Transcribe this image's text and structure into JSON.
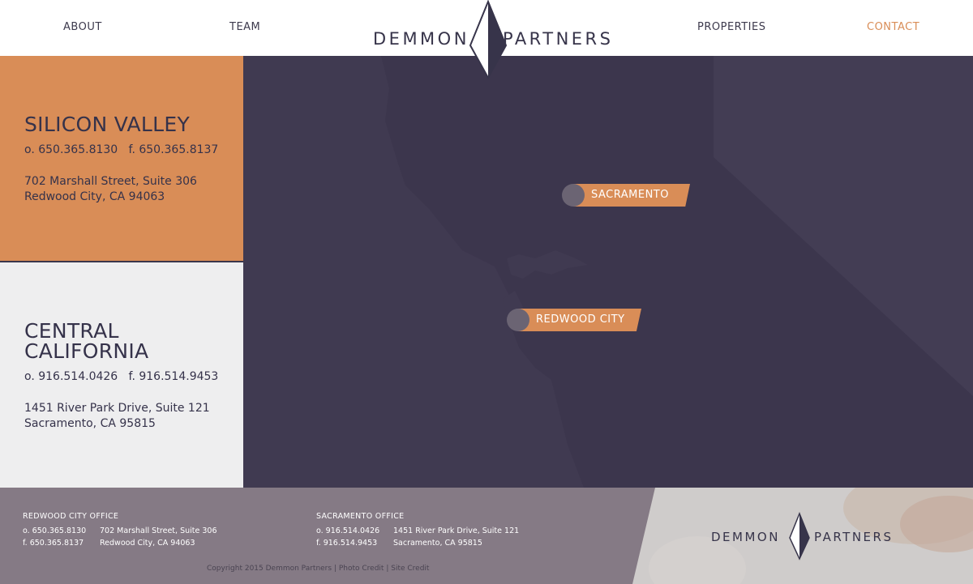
{
  "nav": {
    "about": "ABOUT",
    "team": "TEAM",
    "properties": "PROPERTIES",
    "contact": "CONTACT"
  },
  "logo": {
    "left": "DEMMON",
    "right": "PARTNERS"
  },
  "offices": [
    {
      "title": "SILICON VALLEY",
      "phones": "o. 650.365.8130   f. 650.365.8137",
      "address_line1": "702 Marshall Street, Suite 306",
      "address_line2": "Redwood City, CA 94063"
    },
    {
      "title": "CENTRAL CALIFORNIA",
      "phones": "o. 916.514.0426   f. 916.514.9453",
      "address_line1": "1451 River Park Drive, Suite 121",
      "address_line2": "Sacramento, CA 95815"
    }
  ],
  "map": {
    "pins": [
      "SACRAMENTO",
      "REDWOOD CITY"
    ]
  },
  "footer": {
    "rwc": {
      "title": "REDWOOD CITY OFFICE",
      "office_phone": "o. 650.365.8130",
      "fax": "f. 650.365.8137",
      "street": "702 Marshall Street, Suite 306",
      "city": "Redwood City, CA 94063"
    },
    "sac": {
      "title": "SACRAMENTO OFFICE",
      "office_phone": "o. 916.514.0426",
      "fax": "f. 916.514.9453",
      "street": "1451 River Park Drive, Suite 121",
      "city": "Sacramento, CA 95815"
    },
    "copyright": "Copyright 2015 Demmon Partners |",
    "photo_credit": "Photo Credit",
    "separator": "|",
    "site_credit": "Site Credit"
  },
  "colors": {
    "accent": "#d98d57",
    "navy": "#35324a",
    "map": "#3c364d",
    "footer": "#857a85"
  }
}
